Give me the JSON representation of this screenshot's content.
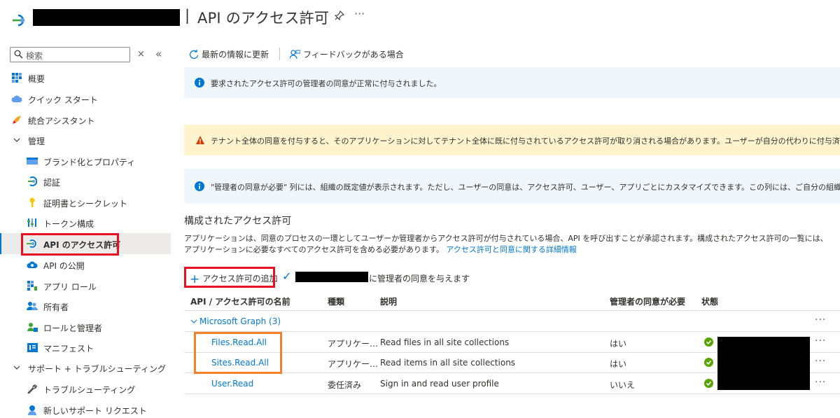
{
  "header": {
    "separator": "|",
    "title": "API のアクセス許可",
    "more": "···"
  },
  "sidebar": {
    "search_placeholder": "検索",
    "clear": "×",
    "collapse": "«",
    "items": [
      {
        "label": "概要",
        "icon": "grid-icon"
      },
      {
        "label": "クイック スタート",
        "icon": "cloud-icon"
      },
      {
        "label": "統合アシスタント",
        "icon": "rocket-icon"
      },
      {
        "label": "管理",
        "icon": "chevron-down-icon"
      },
      {
        "label": "ブランド化とプロパティ",
        "icon": "branding-icon"
      },
      {
        "label": "認証",
        "icon": "auth-icon"
      },
      {
        "label": "証明書とシークレット",
        "icon": "key-icon"
      },
      {
        "label": "トークン構成",
        "icon": "token-icon"
      },
      {
        "label": "API のアクセス許可",
        "icon": "api-icon"
      },
      {
        "label": "API の公開",
        "icon": "cloud-api-icon"
      },
      {
        "label": "アプリ ロール",
        "icon": "app-roles-icon"
      },
      {
        "label": "所有者",
        "icon": "owners-icon"
      },
      {
        "label": "ロールと管理者",
        "icon": "roles-admin-icon"
      },
      {
        "label": "マニフェスト",
        "icon": "manifest-icon"
      },
      {
        "label": "サポート + トラブルシューティング",
        "icon": "chevron-down-icon"
      },
      {
        "label": "トラブルシューティング",
        "icon": "wrench-icon"
      },
      {
        "label": "新しいサポート リクエスト",
        "icon": "support-icon"
      }
    ]
  },
  "toolbar": {
    "refresh": "最新の情報に更新",
    "feedback": "フィードバックがある場合"
  },
  "banners": {
    "success": "要求されたアクセス許可の管理者の同意が正常に付与されました。",
    "warning": "テナント全体の同意を付与すると、そのアプリケーションに対してテナント全体に既に付与されているアクセス許可が取り消される場合があります。ユーザーが自分の代わりに付与済みのアクセス許可は影響を受けま",
    "info": "\"管理者の同意が必要\" 列には、組織の既定値が表示されます。ただし、ユーザーの同意は、アクセス許可、ユーザー、アプリごとにカスタマイズできます。この列には、ご自分の組織や、このアプリが使用される組織"
  },
  "section": {
    "title": "構成されたアクセス許可",
    "description": "アプリケーションは、同意のプロセスの一環としてユーザーか管理者からアクセス許可が付与されている場合、API を呼び出すことが承認されます。構成されたアクセス許可の一覧には、アプリケーションに必要なすべてのアクセス許可を含める必要があります。",
    "link": "アクセス許可と同意に関する詳細情報"
  },
  "actions": {
    "add_permission": "アクセス許可の追加",
    "grant_consent": "に管理者の同意を与えます"
  },
  "table": {
    "headers": [
      "API / アクセス許可の名前",
      "種類",
      "説明",
      "管理者の同意が必要",
      "状態"
    ],
    "group": "Microsoft Graph (3)",
    "rows": [
      {
        "name": "Files.Read.All",
        "type": "アプリケー…",
        "desc": "Read files in all site collections",
        "admin": "はい"
      },
      {
        "name": "Sites.Read.All",
        "type": "アプリケー…",
        "desc": "Read items in all site collections",
        "admin": "はい"
      },
      {
        "name": "User.Read",
        "type": "委任済み",
        "desc": "Sign in and read user profile",
        "admin": "いいえ"
      }
    ],
    "row_more": "···"
  },
  "colors": {
    "accent": "#0078d4",
    "success": "#57a300",
    "warning": "#d83b01",
    "highlight_red": "#e81123",
    "highlight_orange": "#f7802b"
  }
}
